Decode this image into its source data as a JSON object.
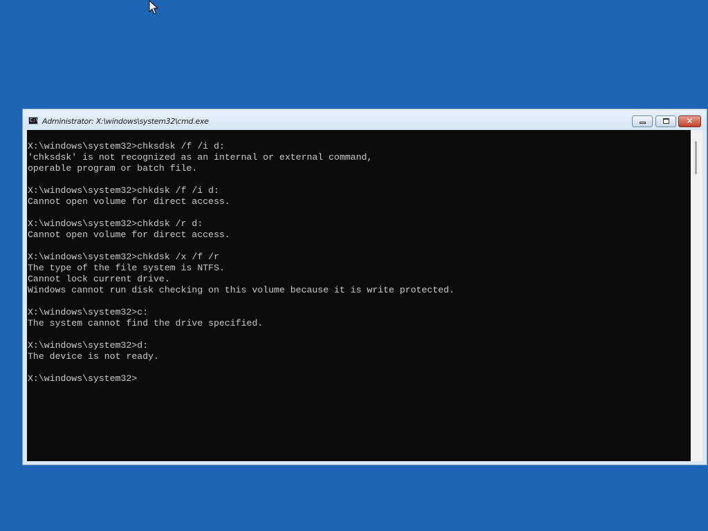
{
  "window": {
    "title": "Administrator: X:\\windows\\system32\\cmd.exe",
    "icon_text": "C:\\",
    "icon": "cmd-icon",
    "buttons": {
      "minimize": "minimize-icon",
      "maximize": "maximize-icon",
      "close": "close-icon",
      "close_glyph": "✕"
    }
  },
  "colors": {
    "desktop": "#1f65b5",
    "console_bg": "#0c0c0c",
    "console_text": "#c8c8c8",
    "close_button": "#c4402a"
  },
  "console": {
    "lines": [
      "X:\\windows\\system32>chksdsk /f /i d:",
      "'chksdsk' is not recognized as an internal or external command,",
      "operable program or batch file.",
      "",
      "X:\\windows\\system32>chkdsk /f /i d:",
      "Cannot open volume for direct access.",
      "",
      "X:\\windows\\system32>chkdsk /r d:",
      "Cannot open volume for direct access.",
      "",
      "X:\\windows\\system32>chkdsk /x /f /r",
      "The type of the file system is NTFS.",
      "Cannot lock current drive.",
      "Windows cannot run disk checking on this volume because it is write protected.",
      "",
      "X:\\windows\\system32>c:",
      "The system cannot find the drive specified.",
      "",
      "X:\\windows\\system32>d:",
      "The device is not ready.",
      "",
      "X:\\windows\\system32>"
    ]
  },
  "cursor": "mouse-pointer-icon"
}
